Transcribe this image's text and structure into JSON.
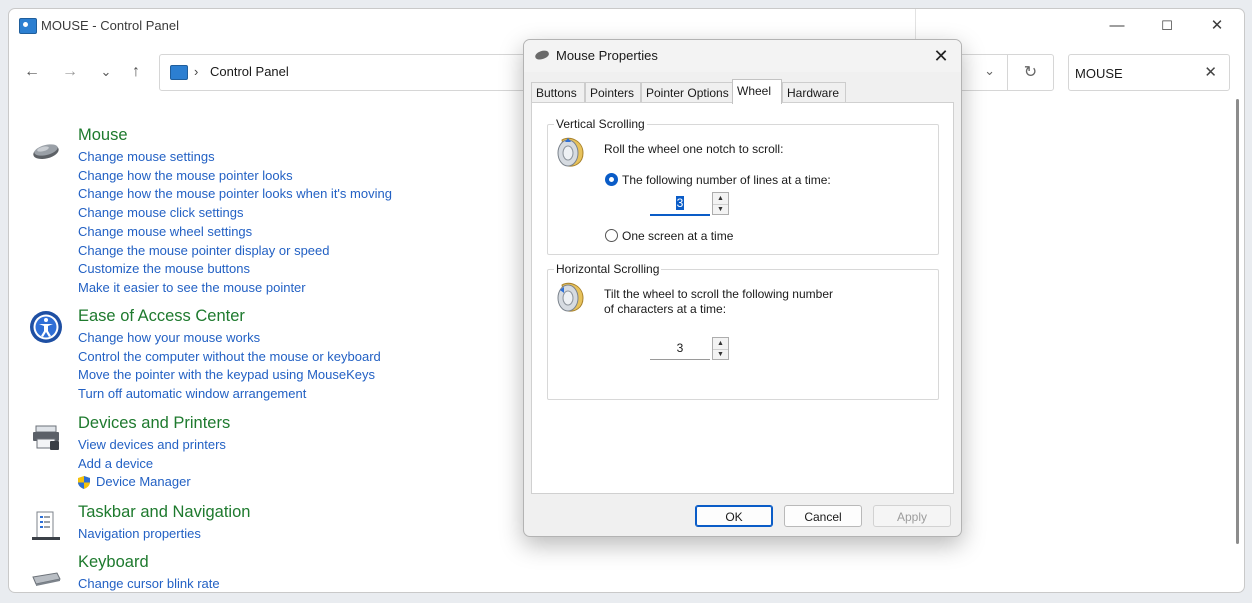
{
  "control_panel": {
    "title": "MOUSE - Control Panel",
    "window_controls": {
      "minimize": "—",
      "maximize": "☐",
      "close": "✕"
    },
    "nav": {
      "back": "←",
      "forward": "→",
      "recent": "⌄",
      "up": "↑"
    },
    "address": {
      "separator": "›",
      "crumb": "Control Panel",
      "dropdown": "⌄",
      "refresh": "↻"
    },
    "search": {
      "value": "MOUSE",
      "clear": "✕"
    },
    "groups": [
      {
        "title": "Mouse",
        "links": [
          "Change mouse settings",
          "Change how the mouse pointer looks",
          "Change how the mouse pointer looks when it's moving",
          "Change mouse click settings",
          "Change mouse wheel settings",
          "Change the mouse pointer display or speed",
          "Customize the mouse buttons",
          "Make it easier to see the mouse pointer"
        ]
      },
      {
        "title": "Ease of Access Center",
        "links": [
          "Change how your mouse works",
          "Control the computer without the mouse or keyboard",
          "Move the pointer with the keypad using MouseKeys",
          "Turn off automatic window arrangement"
        ]
      },
      {
        "title": "Devices and Printers",
        "links": [
          "View devices and printers",
          "Add a device",
          "Device Manager"
        ]
      },
      {
        "title": "Taskbar and Navigation",
        "links": [
          "Navigation properties"
        ]
      },
      {
        "title": "Keyboard",
        "links": [
          "Change cursor blink rate"
        ]
      }
    ]
  },
  "dialog": {
    "title": "Mouse Properties",
    "close": "✕",
    "tabs": [
      {
        "label": "Buttons",
        "active": false
      },
      {
        "label": "Pointers",
        "active": false
      },
      {
        "label": "Pointer Options",
        "active": false
      },
      {
        "label": "Wheel",
        "active": true
      },
      {
        "label": "Hardware",
        "active": false
      }
    ],
    "vertical": {
      "legend": "Vertical Scrolling",
      "intro": "Roll the wheel one notch to scroll:",
      "option_lines": "The following number of lines at a time:",
      "lines_value": "3",
      "option_screen": "One screen at a time",
      "selected": "lines"
    },
    "horizontal": {
      "legend": "Horizontal Scrolling",
      "intro_line1": "Tilt the wheel to scroll the following number",
      "intro_line2": "of characters at a time:",
      "chars_value": "3"
    },
    "buttons": {
      "ok": "OK",
      "cancel": "Cancel",
      "apply": "Apply"
    },
    "colors": {
      "accent": "#0a5cc7",
      "link": "#2361c4",
      "heading": "#1e7a2e"
    }
  }
}
